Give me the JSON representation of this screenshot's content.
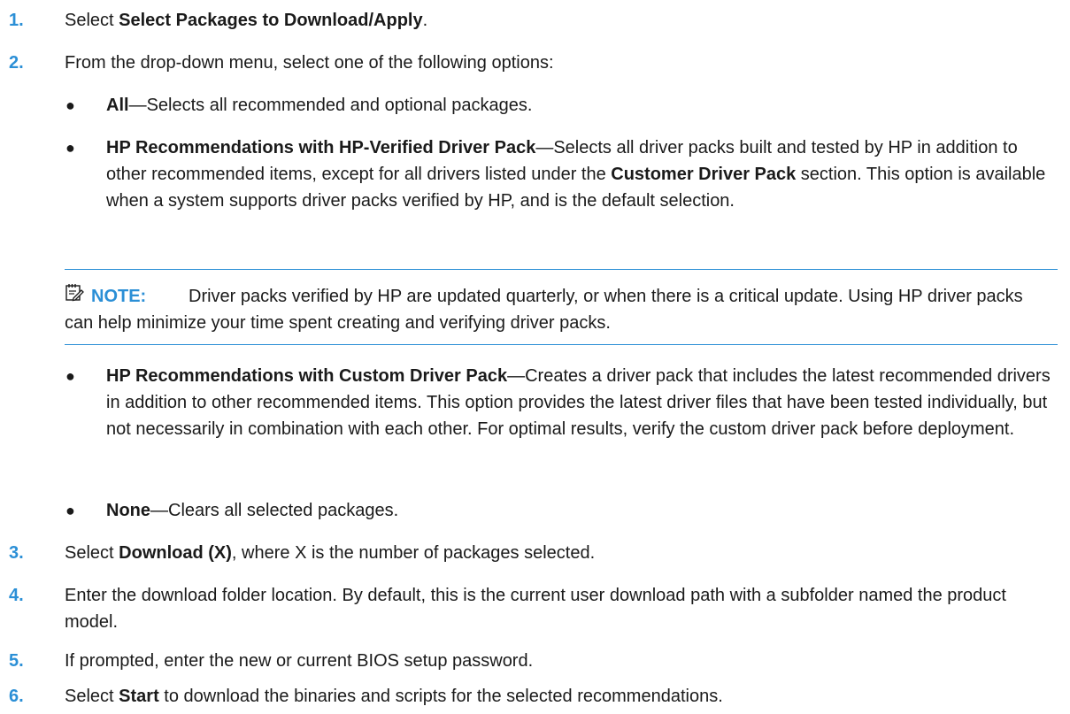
{
  "steps": [
    {
      "num": "1.",
      "pre": "Select ",
      "bold": "Select Packages to Download/Apply",
      "post": "."
    },
    {
      "num": "2.",
      "text": "From the drop-down menu, select one of the following options:"
    },
    {
      "num": "3.",
      "pre": "Select ",
      "bold": "Download (X)",
      "post": ", where X is the number of packages selected."
    },
    {
      "num": "4.",
      "text": "Enter the download folder location. By default, this is the current user download path with a subfolder named the product model."
    },
    {
      "num": "5.",
      "text": "If prompted, enter the new or current BIOS setup password."
    },
    {
      "num": "6.",
      "pre": "Select ",
      "bold": "Start",
      "post": " to download the binaries and scripts for the selected recommendations."
    }
  ],
  "options": [
    {
      "bullet": "●",
      "bold": "All",
      "text": "—Selects all recommended and optional packages."
    },
    {
      "bullet": "●",
      "bold": "HP Recommendations with HP-Verified Driver Pack",
      "text": "—Selects all driver packs built and tested by HP in addition to other recommended items, except for all drivers listed under the ",
      "bold2": "Customer Driver Pack",
      "text2": " section. This option is available when a system supports driver packs verified by HP, and is the default selection."
    },
    {
      "bullet": "●",
      "bold": "HP Recommendations with Custom Driver Pack",
      "text": "—Creates a driver pack that includes the latest recommended drivers in addition to other recommended items. This option provides the latest driver files that have been tested individually, but not necessarily in combination with each other. For optimal results, verify the custom driver pack before deployment."
    },
    {
      "bullet": "●",
      "bold": "None",
      "text": "—Clears all selected packages."
    }
  ],
  "note": {
    "label": "NOTE:",
    "text": "Driver packs verified by HP are updated quarterly, or when there is a critical update. Using HP driver packs can help minimize your time spent creating and verifying driver packs.",
    "icon": "note-icon",
    "accent_color": "#2b8fd6"
  }
}
